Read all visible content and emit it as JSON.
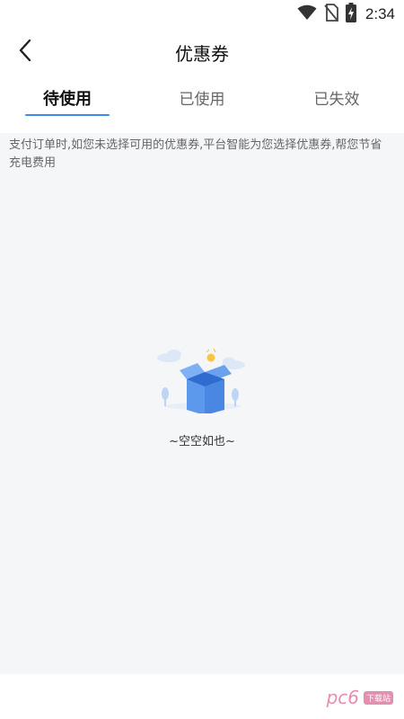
{
  "status_bar": {
    "time": "2:34",
    "icons": [
      "wifi-icon",
      "no-sim-icon",
      "battery-charging-icon"
    ]
  },
  "header": {
    "title": "优惠券",
    "back_icon": "chevron-left-icon"
  },
  "tabs": [
    {
      "label": "待使用",
      "active": true
    },
    {
      "label": "已使用",
      "active": false
    },
    {
      "label": "已失效",
      "active": false
    }
  ],
  "notice": "支付订单时,如您未选择可用的优惠券,平台智能为您选择优惠券,帮您节省充电费用",
  "empty_state": {
    "illustration": "empty-box-illustration",
    "text": "~空空如也~"
  },
  "watermark": {
    "text": "pc6",
    "badge": "下载站"
  },
  "colors": {
    "accent": "#3d8bf2",
    "background": "#f5f6f8"
  }
}
